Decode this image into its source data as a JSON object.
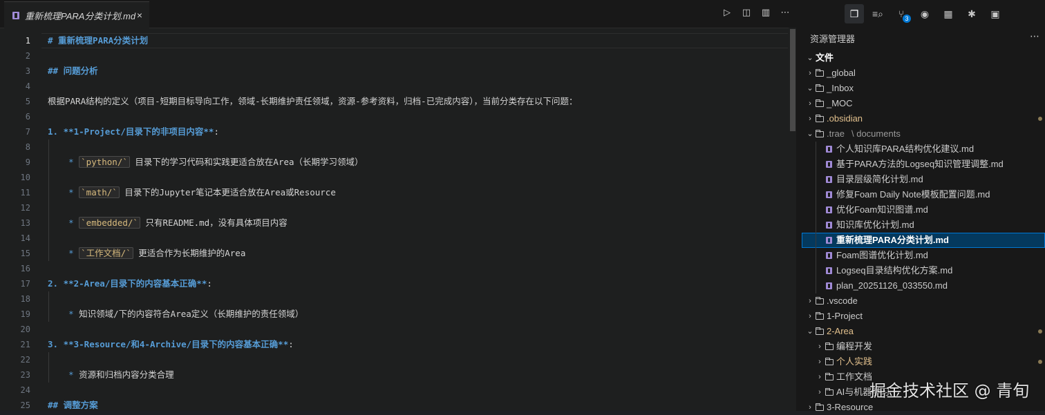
{
  "tab": {
    "title": "重新梳理PARA分类计划.md",
    "close": "×"
  },
  "tab_actions": {
    "run": "▷",
    "preview": "◫",
    "split": "▥",
    "more": "⋯"
  },
  "editor": {
    "lines": [
      {
        "n": "1",
        "segments": [
          {
            "t": "# 重新梳理PARA分类计划",
            "c": "h"
          }
        ],
        "active": true
      },
      {
        "n": "2",
        "segments": []
      },
      {
        "n": "3",
        "segments": [
          {
            "t": "## 问题分析",
            "c": "h"
          }
        ]
      },
      {
        "n": "4",
        "segments": []
      },
      {
        "n": "5",
        "segments": [
          {
            "t": "根据PARA结构的定义（项目-短期目标导向工作，领域-长期维护责任领域，资源-参考资料，归档-已完成内容），当前分类存在以下问题：",
            "c": ""
          }
        ]
      },
      {
        "n": "6",
        "segments": []
      },
      {
        "n": "7",
        "segments": [
          {
            "t": "1. **1-Project/目录下的非项目内容**",
            "c": "b"
          },
          {
            "t": ":",
            "c": ""
          }
        ]
      },
      {
        "n": "8",
        "segments": []
      },
      {
        "n": "9",
        "segments": [
          {
            "t": "    * ",
            "c": "bullet"
          },
          {
            "t": "`python/`",
            "c": "code"
          },
          {
            "t": " 目录下的学习代码和实践更适合放在Area（长期学习领域）",
            "c": ""
          }
        ]
      },
      {
        "n": "10",
        "segments": []
      },
      {
        "n": "11",
        "segments": [
          {
            "t": "    * ",
            "c": "bullet"
          },
          {
            "t": "`math/`",
            "c": "code"
          },
          {
            "t": " 目录下的Jupyter笔记本更适合放在Area或Resource",
            "c": ""
          }
        ]
      },
      {
        "n": "12",
        "segments": []
      },
      {
        "n": "13",
        "segments": [
          {
            "t": "    * ",
            "c": "bullet"
          },
          {
            "t": "`embedded/`",
            "c": "code"
          },
          {
            "t": " 只有README.md，没有具体项目内容",
            "c": ""
          }
        ]
      },
      {
        "n": "14",
        "segments": []
      },
      {
        "n": "15",
        "segments": [
          {
            "t": "    * ",
            "c": "bullet"
          },
          {
            "t": "`工作文档/`",
            "c": "code"
          },
          {
            "t": " 更适合作为长期维护的Area",
            "c": ""
          }
        ]
      },
      {
        "n": "16",
        "segments": []
      },
      {
        "n": "17",
        "segments": [
          {
            "t": "2. **2-Area/目录下的内容基本正确**",
            "c": "b"
          },
          {
            "t": ":",
            "c": ""
          }
        ]
      },
      {
        "n": "18",
        "segments": []
      },
      {
        "n": "19",
        "segments": [
          {
            "t": "    * ",
            "c": "bullet"
          },
          {
            "t": "知识领域/下的内容符合Area定义（长期维护的责任领域）",
            "c": ""
          }
        ]
      },
      {
        "n": "20",
        "segments": []
      },
      {
        "n": "21",
        "segments": [
          {
            "t": "3. **3-Resource/和4-Archive/目录下的内容基本正确**",
            "c": "b"
          },
          {
            "t": ":",
            "c": ""
          }
        ]
      },
      {
        "n": "22",
        "segments": []
      },
      {
        "n": "23",
        "segments": [
          {
            "t": "    * ",
            "c": "bullet"
          },
          {
            "t": "资源和归档内容分类合理",
            "c": ""
          }
        ]
      },
      {
        "n": "24",
        "segments": []
      },
      {
        "n": "25",
        "segments": [
          {
            "t": "## 调整方案",
            "c": "h"
          }
        ]
      }
    ]
  },
  "activity_icons": [
    {
      "name": "explorer-icon",
      "glyph": "❐",
      "selected": true
    },
    {
      "name": "search-icon",
      "glyph": "≡⌕"
    },
    {
      "name": "source-control-icon",
      "glyph": "⑂",
      "badge": "3"
    },
    {
      "name": "eye-icon",
      "glyph": "◉"
    },
    {
      "name": "extensions-icon",
      "glyph": "▦"
    },
    {
      "name": "debug-icon",
      "glyph": "✱"
    },
    {
      "name": "remote-icon",
      "glyph": "▣"
    }
  ],
  "sidebar": {
    "title": "资源管理器",
    "more": "⋯",
    "tree": [
      {
        "depth": 0,
        "kind": "root",
        "chev": "⌄",
        "label": "文件"
      },
      {
        "depth": 1,
        "kind": "folder",
        "chev": "›",
        "label": "_global"
      },
      {
        "depth": 1,
        "kind": "folder-open",
        "chev": "⌄",
        "label": "_Inbox"
      },
      {
        "depth": 1,
        "kind": "folder",
        "chev": "›",
        "label": "_MOC"
      },
      {
        "depth": 1,
        "kind": "folder",
        "chev": "›",
        "label": ".obsidian",
        "mod": true,
        "dot": true
      },
      {
        "depth": 1,
        "kind": "folder-open",
        "chev": "⌄",
        "label": ".trae",
        "sub": "\\ documents",
        "dim": true
      },
      {
        "depth": 2,
        "kind": "md",
        "label": "个人知识库PARA结构优化建议.md"
      },
      {
        "depth": 2,
        "kind": "md",
        "label": "基于PARA方法的Logseq知识管理调整.md"
      },
      {
        "depth": 2,
        "kind": "md",
        "label": "目录层级简化计划.md"
      },
      {
        "depth": 2,
        "kind": "md",
        "label": "修复Foam Daily Note模板配置问题.md"
      },
      {
        "depth": 2,
        "kind": "md",
        "label": "优化Foam知识图谱.md"
      },
      {
        "depth": 2,
        "kind": "md",
        "label": "知识库优化计划.md"
      },
      {
        "depth": 2,
        "kind": "md",
        "label": "重新梳理PARA分类计划.md",
        "selected": true
      },
      {
        "depth": 2,
        "kind": "md",
        "label": "Foam图谱优化计划.md"
      },
      {
        "depth": 2,
        "kind": "md",
        "label": "Logseq目录结构优化方案.md"
      },
      {
        "depth": 2,
        "kind": "md",
        "label": "plan_20251126_033550.md"
      },
      {
        "depth": 1,
        "kind": "folder",
        "chev": "›",
        "label": ".vscode"
      },
      {
        "depth": 1,
        "kind": "folder",
        "chev": "›",
        "label": "1-Project"
      },
      {
        "depth": 1,
        "kind": "folder-open",
        "chev": "⌄",
        "label": "2-Area",
        "mod": true,
        "dot": true
      },
      {
        "depth": 2,
        "kind": "folder",
        "chev": "›",
        "label": "编程开发"
      },
      {
        "depth": 2,
        "kind": "folder",
        "chev": "›",
        "label": "个人实践",
        "mod": true,
        "dot": true
      },
      {
        "depth": 2,
        "kind": "folder",
        "chev": "›",
        "label": "工作文档"
      },
      {
        "depth": 2,
        "kind": "folder",
        "chev": "›",
        "label": "AI与机器学习"
      },
      {
        "depth": 1,
        "kind": "folder",
        "chev": "›",
        "label": "3-Resource"
      }
    ]
  },
  "watermark": "掘金技术社区 @ 青旬"
}
